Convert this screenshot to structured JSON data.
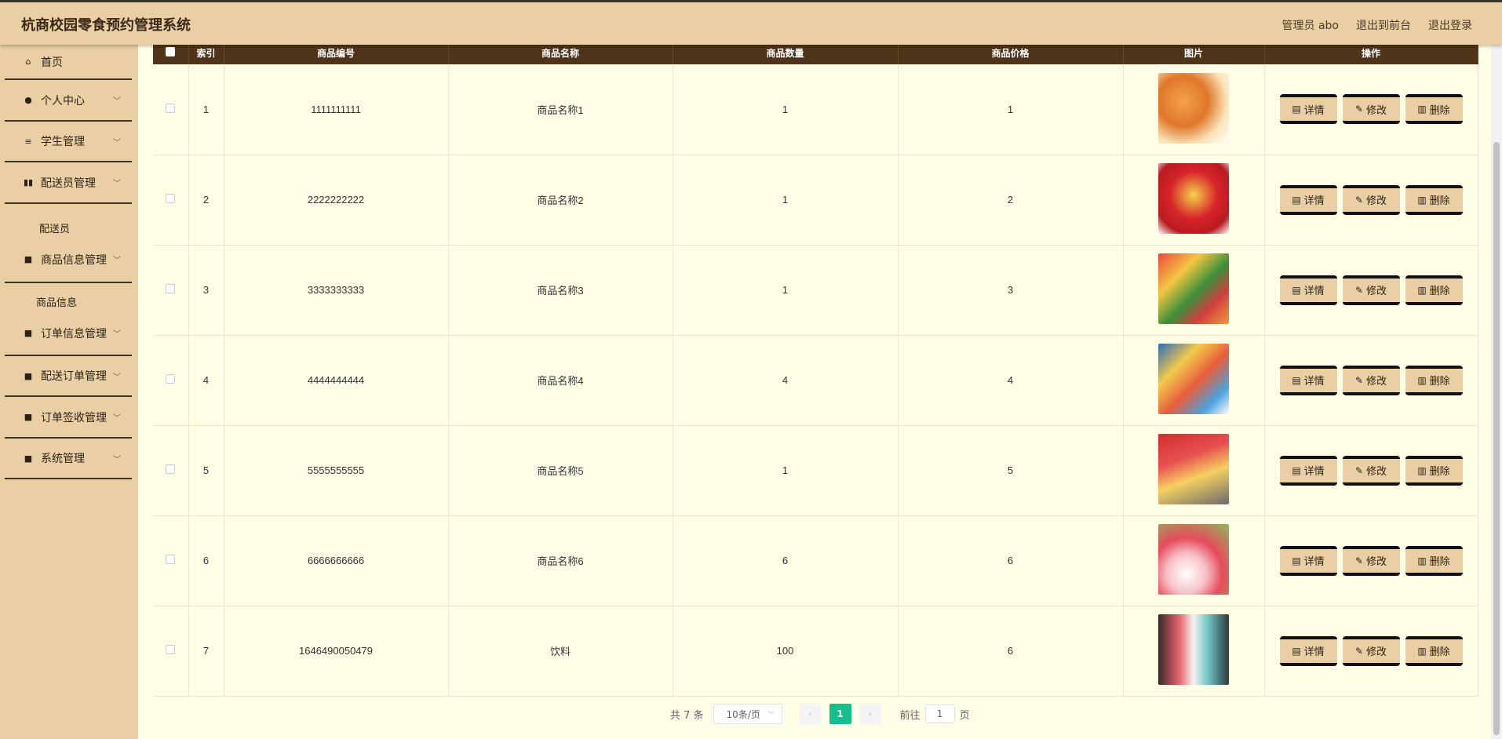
{
  "header": {
    "title": "杭商校园零食预约管理系统",
    "admin_label": "管理员 abo",
    "front_link": "退出到前台",
    "logout_link": "退出登录"
  },
  "sidebar": {
    "items": [
      {
        "label": "首页",
        "icon": "home-icon"
      },
      {
        "label": "个人中心",
        "icon": "user-icon"
      },
      {
        "label": "学生管理",
        "icon": "list-icon"
      },
      {
        "label": "配送员管理",
        "icon": "chart-icon"
      },
      {
        "label": "配送员"
      },
      {
        "label": "商品信息管理",
        "icon": "grid-icon"
      },
      {
        "label": "商品信息"
      },
      {
        "label": "订单信息管理",
        "icon": "grid-icon"
      },
      {
        "label": "配送订单管理",
        "icon": "grid-icon"
      },
      {
        "label": "订单签收管理",
        "icon": "grid-icon"
      },
      {
        "label": "系统管理",
        "icon": "grid-icon"
      }
    ]
  },
  "table": {
    "headers": [
      "索引",
      "商品编号",
      "商品名称",
      "商品数量",
      "商品价格",
      "图片",
      "操作"
    ],
    "rows": [
      {
        "index": "1",
        "code": "1111111111",
        "name": "商品名称1",
        "qty": "1",
        "price": "1"
      },
      {
        "index": "2",
        "code": "2222222222",
        "name": "商品名称2",
        "qty": "1",
        "price": "2"
      },
      {
        "index": "3",
        "code": "3333333333",
        "name": "商品名称3",
        "qty": "1",
        "price": "3"
      },
      {
        "index": "4",
        "code": "4444444444",
        "name": "商品名称4",
        "qty": "4",
        "price": "4"
      },
      {
        "index": "5",
        "code": "5555555555",
        "name": "商品名称5",
        "qty": "1",
        "price": "5"
      },
      {
        "index": "6",
        "code": "6666666666",
        "name": "商品名称6",
        "qty": "6",
        "price": "6"
      },
      {
        "index": "7",
        "code": "1646490050479",
        "name": "饮料",
        "qty": "100",
        "price": "6"
      }
    ],
    "actions": {
      "detail": "详情",
      "edit": "修改",
      "delete": "删除"
    }
  },
  "pagination": {
    "total": "共 7 条",
    "page_size": "10条/页",
    "current": "1",
    "goto_label": "前往",
    "goto_value": "1",
    "goto_suffix": "页"
  },
  "colors": {
    "header_bg": "#4f3419",
    "sidebar_bg": "#e9cfa3",
    "page_bg": "#fefee6",
    "accent": "#13c08b"
  }
}
